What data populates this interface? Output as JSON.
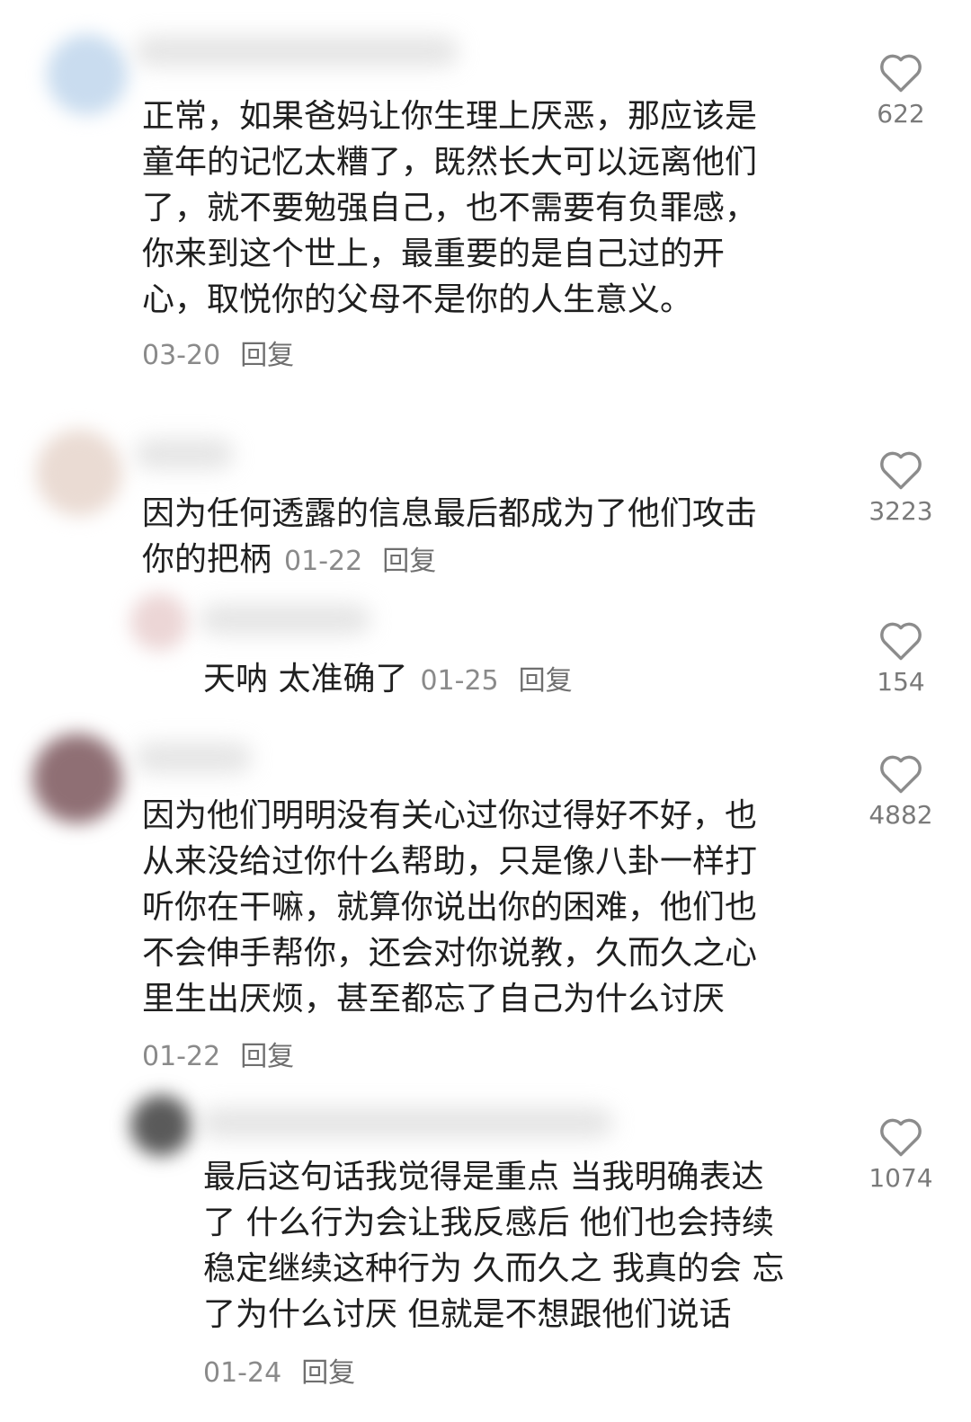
{
  "comments": [
    {
      "text": "正常，如果爸妈让你生理上厌恶，那应该是\n童年的记忆太糟了，既然长大可以远离他们\n了，就不要勉强自己，也不需要有负罪感，\n你来到这个世上，最重要的是自己过的开\n心，取悦你的父母不是你的人生意义。",
      "date": "03-20",
      "reply_label": "回复",
      "likes": "622"
    },
    {
      "text": "因为任何透露的信息最后都成为了他们攻击\n你的把柄",
      "date": "01-22",
      "reply_label": "回复",
      "likes": "3223"
    },
    {
      "text": "天呐 太准确了",
      "date": "01-25",
      "reply_label": "回复",
      "likes": "154"
    },
    {
      "text": "因为他们明明没有关心过你过得好不好，也\n从来没给过你什么帮助，只是像八卦一样打\n听你在干嘛，就算你说出你的困难，他们也\n不会伸手帮你，还会对你说教，久而久之心\n里生出厌烦，甚至都忘了自己为什么讨厌",
      "date": "01-22",
      "reply_label": "回复",
      "likes": "4882"
    },
    {
      "text": "最后这句话我觉得是重点 当我明确表达\n了 什么行为会让我反感后 他们也会持续\n稳定继续这种行为 久而久之 我真的会 忘\n了为什么讨厌 但就是不想跟他们说话",
      "date": "01-24",
      "reply_label": "回复",
      "likes": "1074"
    }
  ],
  "icons": {
    "like": "heart-outline-icon"
  },
  "colors": {
    "text": "#1f1f1f",
    "meta": "#8a8a8a",
    "like_stroke": "#8c8c8c"
  }
}
